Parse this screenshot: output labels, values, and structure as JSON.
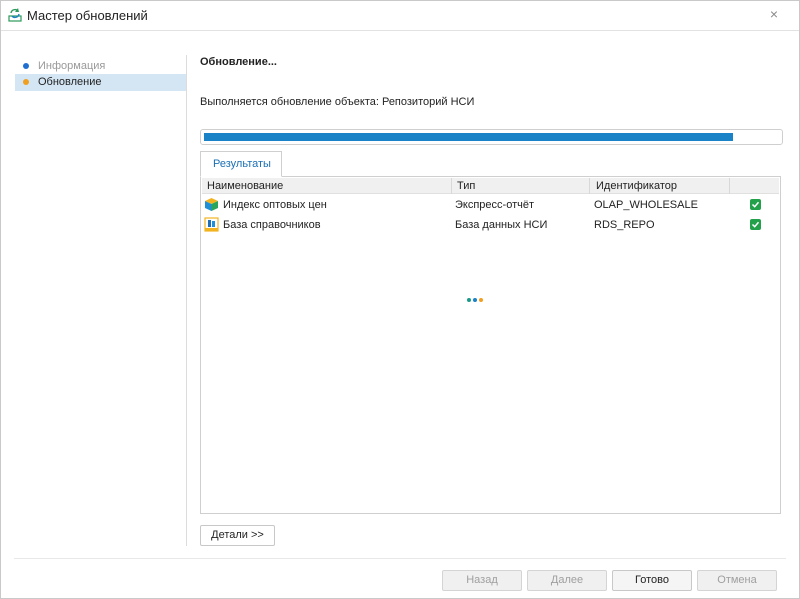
{
  "window": {
    "title": "Мастер обновлений",
    "close_glyph": "×"
  },
  "sidebar": {
    "items": [
      {
        "label": "Информация",
        "state": "done",
        "dot_color": "#1f6fd1"
      },
      {
        "label": "Обновление",
        "state": "active",
        "dot_color": "#f0a020"
      }
    ]
  },
  "main": {
    "title": "Обновление...",
    "status": "Выполняется обновление объекта: Репозиторий НСИ",
    "progress": 0.92,
    "tabs": [
      {
        "label": "Результаты"
      }
    ]
  },
  "results": {
    "columns": [
      "Наименование",
      "Тип",
      "Идентификатор"
    ],
    "rows": [
      {
        "name": "Индекс оптовых цен",
        "type": "Экспресс-отчёт",
        "id": "OLAP_WHOLESALE",
        "icon": "express-report-icon",
        "checked": true
      },
      {
        "name": "База справочников",
        "type": "База данных НСИ",
        "id": "RDS_REPO",
        "icon": "mdm-database-icon",
        "checked": true
      }
    ]
  },
  "buttons": {
    "details": "Детали >>",
    "back": "Назад",
    "next": "Далее",
    "finish": "Готово",
    "cancel": "Отмена"
  },
  "colors": {
    "accent": "#1a82c6",
    "selection": "#d4e6f4",
    "check": "#23a14a"
  }
}
